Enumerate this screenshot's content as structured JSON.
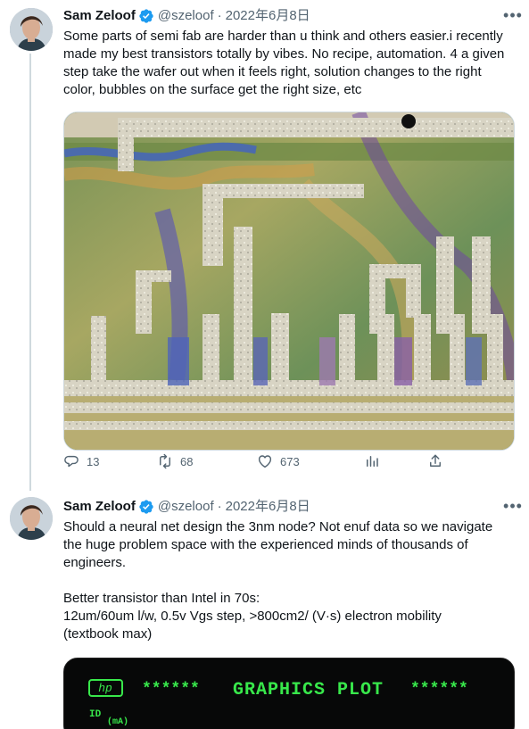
{
  "tweets": [
    {
      "author": {
        "name": "Sam Zeloof",
        "handle": "@szeloof",
        "verified": true
      },
      "date": "2022年6月8日",
      "text": "Some parts of semi fab are harder than u think and others easier.i recently made my best transistors totally by vibes. No recipe, automation. 4 a given step take the wafer out when it feels right, solution changes to the right color, bubbles on the surface get the right size, etc",
      "stats": {
        "reply_count": "13",
        "retweet_count": "68",
        "like_count": "673"
      }
    },
    {
      "author": {
        "name": "Sam Zeloof",
        "handle": "@szeloof",
        "verified": true
      },
      "date": "2022年6月8日",
      "text": "Should a neural net design the 3nm node? Not enuf data so we navigate the huge problem space with the experienced minds of thousands of engineers.\n\nBetter transistor than Intel in 70s:\n12um/60um l/w, 0.5v Vgs step, >800cm2/ (V·s) electron mobility\n(textbook  max)",
      "image_text": {
        "logo": "hp",
        "stars_left": "******",
        "title": "GRAPHICS PLOT",
        "stars_right": "******",
        "axis_label": "ID",
        "axis_unit": "(mA)"
      }
    }
  ],
  "ui": {
    "separator": "·",
    "more_icon": "more-horizontal-icon",
    "reply_icon": "reply-icon",
    "retweet_icon": "retweet-icon",
    "like_icon": "heart-icon",
    "views_icon": "views-icon",
    "share_icon": "share-icon",
    "verified_color": "#1d9bf0",
    "text_color": "#0f1419",
    "secondary_color": "#536471",
    "plot_green": "#38e84b"
  }
}
